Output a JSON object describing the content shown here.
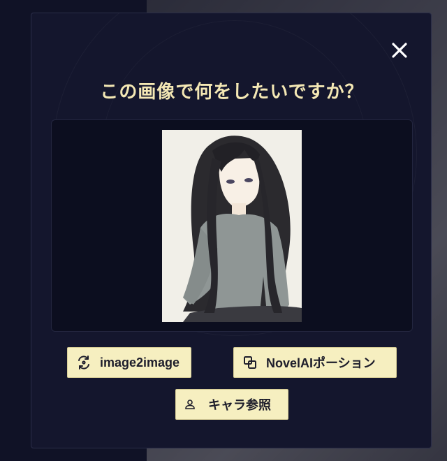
{
  "dialog": {
    "title": "この画像で何をしたいですか？",
    "close_label": "✕"
  },
  "actions": {
    "image2image_label": "image2image",
    "novelai_potion_label": "NovelAIポーション",
    "character_ref_label": "キャラ参照"
  },
  "icons": {
    "close": "close-icon",
    "image2image": "refresh-image-icon",
    "novelai_potion": "copy-layers-icon",
    "character_ref": "person-icon"
  },
  "colors": {
    "accent": "#f4e8b4",
    "button_bg": "#f6efc0",
    "dialog_bg": "#14162d",
    "panel_bg": "#0c0e1f"
  }
}
